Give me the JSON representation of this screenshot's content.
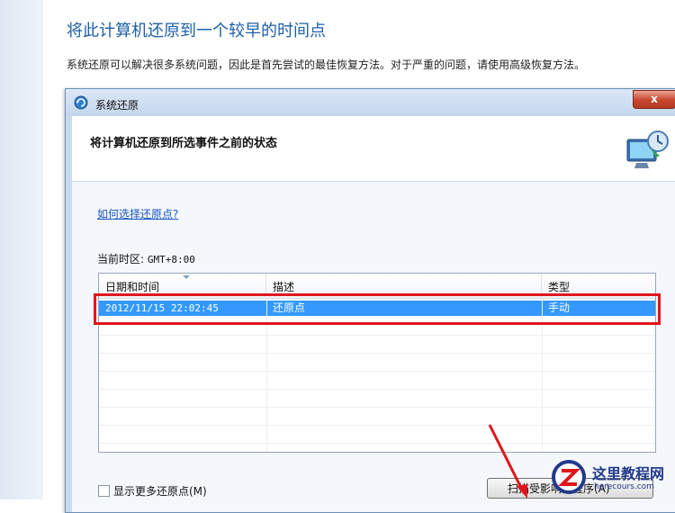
{
  "page": {
    "title": "将此计算机还原到一个较早的时间点",
    "description": "系统还原可以解决很多系统问题，因此是首先尝试的最佳恢复方法。对于严重的问题，请使用高级恢复方法。"
  },
  "dialog": {
    "title": "系统还原",
    "close_label": "x",
    "header": "将计算机还原到所选事件之前的状态",
    "help_link": "如何选择还原点?",
    "timezone_label": "当前时区:",
    "timezone_value": "GMT+8:00",
    "table": {
      "columns": [
        "日期和时间",
        "描述",
        "类型"
      ],
      "rows": [
        {
          "date": "2012/11/15 22:02:45",
          "description": "还原点",
          "type": "手动",
          "selected": true
        }
      ]
    },
    "show_more_label": "显示更多还原点(M)",
    "scan_button_label": "扫描受影响的程序(A)"
  },
  "watermark": {
    "name": "这里教程网",
    "site": "herecours.com"
  },
  "colors": {
    "selection": "#3399ff",
    "highlight": "#e0161d",
    "link": "#1a56c4",
    "title": "#1e5fa8"
  }
}
